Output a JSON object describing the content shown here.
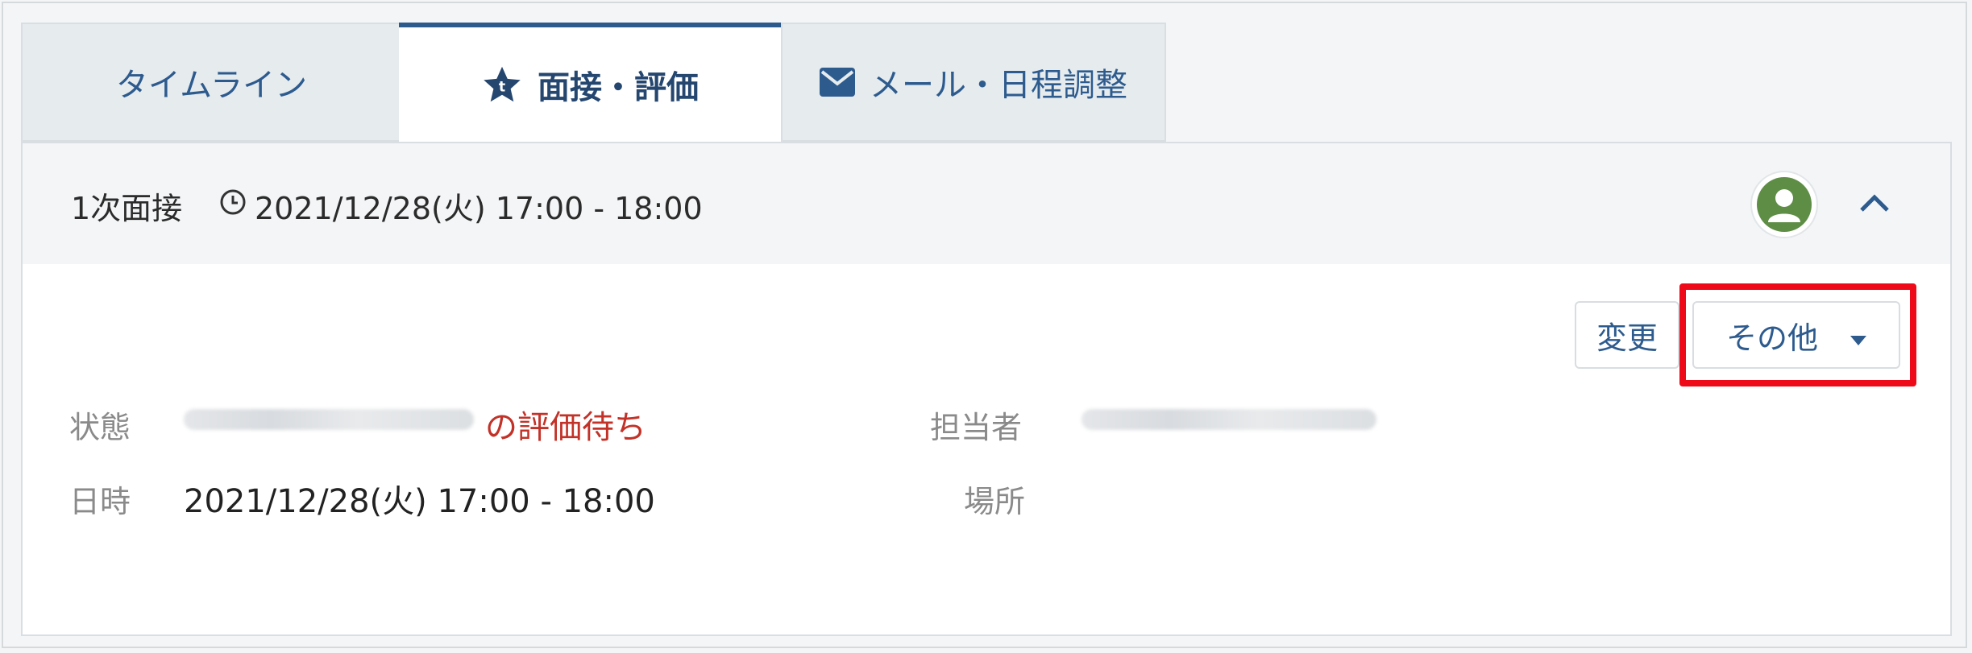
{
  "tabs": [
    {
      "label": "タイムライン",
      "icon": "",
      "active": false
    },
    {
      "label": "面接・評価",
      "icon": "star-icon",
      "active": true
    },
    {
      "label": "メール・日程調整",
      "icon": "mail-icon",
      "active": false
    }
  ],
  "interview": {
    "title": "1次面接",
    "time": "2021/12/28(火) 17:00 - 18:00"
  },
  "actions": {
    "change_label": "変更",
    "other_label": "その他"
  },
  "details": {
    "status_label": "状態",
    "status_value": "の評価待ち",
    "datetime_label": "日時",
    "datetime_value": "2021/12/28(火) 17:00 - 18:00",
    "assignee_label": "担当者",
    "location_label": "場所"
  },
  "colors": {
    "accent": "#2c5a8c",
    "status_text": "#c23228",
    "highlight": "#ee0a18",
    "avatar": "#5e8d46"
  }
}
